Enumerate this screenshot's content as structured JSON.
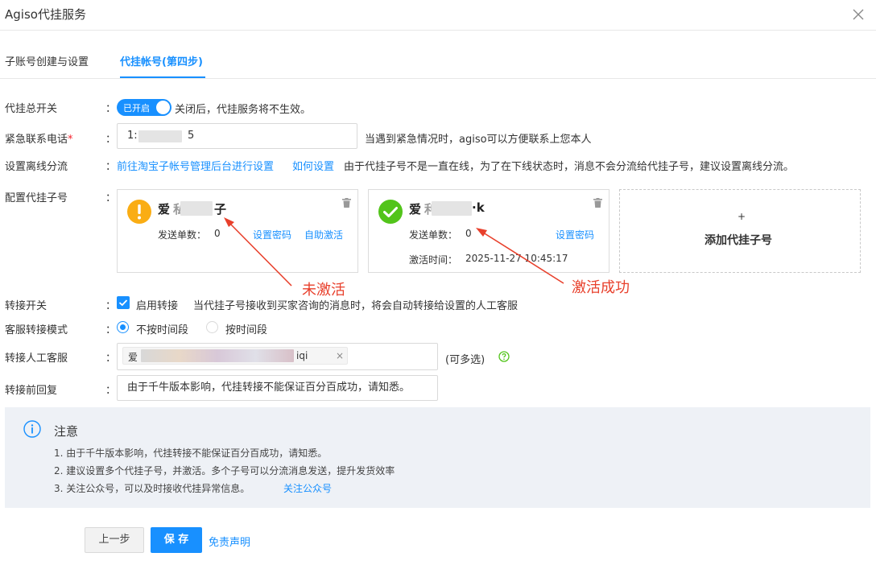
{
  "window": {
    "title": "Agiso代挂服务"
  },
  "tabs": [
    {
      "label": "子账号创建与设置"
    },
    {
      "label": "代挂帐号(第四步)"
    }
  ],
  "form": {
    "master_switch": {
      "label": "代挂总开关",
      "colon": "：",
      "state": "已开启",
      "hint": "关闭后，代挂服务将不生效。"
    },
    "phone": {
      "label": "紧急联系电话",
      "required": "*",
      "colon": "：",
      "value_start": "1:",
      "value_end": "5",
      "hint": "当遇到紧急情况时，agiso可以方便联系上您本人"
    },
    "offline": {
      "label": "设置离线分流",
      "colon": "：",
      "link1": "前往淘宝子帐号管理后台进行设置",
      "link2": "如何设置",
      "hint": "由于代挂子号不是一直在线，为了在下线状态时，消息不会分流给代挂子号，建议设置离线分流。"
    },
    "accounts": {
      "label": "配置代挂子号",
      "colon": "：",
      "cards": [
        {
          "name_start": "爱",
          "name_mid": "私",
          "name_end": "子",
          "status_icon": "warning-icon",
          "send_label": "发送单数：",
          "send_count": "0",
          "set_password": "设置密码",
          "activate": "自助激活"
        },
        {
          "name_start": "爱",
          "name_mid": "利",
          "name_end": "·k",
          "status_icon": "check-circle-icon",
          "send_label": "发送单数：",
          "send_count": "0",
          "set_password": "设置密码",
          "activated_label": "激活时间：",
          "activated_time": "2025-11-27 10:45:17"
        }
      ],
      "add_plus": "+",
      "add_label": "添加代挂子号"
    },
    "transfer_switch": {
      "label": "转接开关",
      "colon": "：",
      "checkbox_label": "启用转接",
      "hint": "当代挂子号接收到买家咨询的消息时，将会自动转接给设置的人工客服"
    },
    "transfer_mode": {
      "label": "客服转接模式",
      "colon": "：",
      "options": [
        "不按时间段",
        "按时间段"
      ],
      "selected": "不按时间段"
    },
    "agent": {
      "label": "转接人工客服",
      "colon": "：",
      "tag_start": "爱",
      "tag_end": "iqi",
      "tag_close": "×",
      "note": "(可多选)",
      "help_icon": "help-circle-icon"
    },
    "pre_reply": {
      "label": "转接前回复",
      "colon": "：",
      "value": "由于千牛版本影响，代挂转接不能保证百分百成功，请知悉。"
    }
  },
  "annotations": {
    "inactive": "未激活",
    "active": "激活成功"
  },
  "notice": {
    "icon": "info-icon",
    "title": "注意",
    "lines": [
      "1. 由于千牛版本影响，代挂转接不能保证百分百成功，请知悉。",
      "2. 建议设置多个代挂子号，并激活。多个子号可以分流消息发送，提升发货效率",
      "3. 关注公众号，可以及时接收代挂异常信息。"
    ],
    "link": "关注公众号"
  },
  "footer": {
    "prev": "上一步",
    "save": "保 存",
    "disclaimer": "免责声明"
  },
  "colors": {
    "primary": "#1890ff",
    "warning": "#faad14",
    "success": "#52c41a",
    "annotation": "#e8402c"
  }
}
